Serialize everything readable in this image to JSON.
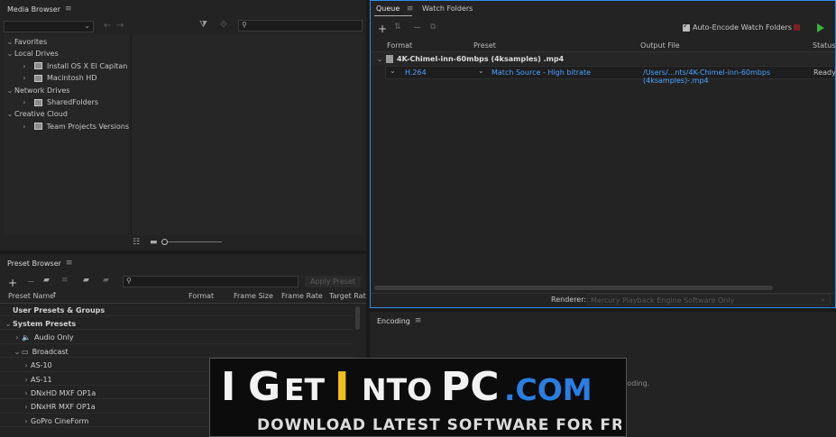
{
  "media_browser": {
    "title": "Media Browser",
    "tree": [
      {
        "label": "Favorites",
        "level": 0,
        "expanded": true,
        "icon": "none"
      },
      {
        "label": "Local Drives",
        "level": 0,
        "expanded": true,
        "icon": "none"
      },
      {
        "label": "Install OS X El Capitan",
        "level": 1,
        "expanded": false,
        "icon": "drive-icon"
      },
      {
        "label": "Macintosh HD",
        "level": 1,
        "expanded": false,
        "icon": "drive-icon"
      },
      {
        "label": "Network Drives",
        "level": 0,
        "expanded": true,
        "icon": "none"
      },
      {
        "label": "SharedFolders",
        "level": 1,
        "expanded": false,
        "icon": "drive-icon"
      },
      {
        "label": "Creative Cloud",
        "level": 0,
        "expanded": true,
        "icon": "none"
      },
      {
        "label": "Team Projects Versions",
        "level": 1,
        "expanded": false,
        "icon": "team-projects-icon"
      }
    ]
  },
  "preset_browser": {
    "title": "Preset Browser",
    "apply_preset": "Apply Preset",
    "columns": [
      "Preset Name",
      "Format",
      "Frame Size",
      "Frame Rate",
      "Target Rat"
    ],
    "rows": [
      {
        "label": "User Presets & Groups",
        "level": 0,
        "chev": "",
        "bold": true
      },
      {
        "label": "System Presets",
        "level": 0,
        "chev": "v",
        "bold": true
      },
      {
        "label": "Audio Only",
        "level": 1,
        "chev": ">",
        "icon": "speaker-icon"
      },
      {
        "label": "Broadcast",
        "level": 1,
        "chev": "v",
        "icon": "tv-icon"
      },
      {
        "label": "AS-10",
        "level": 2,
        "chev": ">"
      },
      {
        "label": "AS-11",
        "level": 2,
        "chev": ">"
      },
      {
        "label": "DNxHD MXF OP1a",
        "level": 2,
        "chev": ">"
      },
      {
        "label": "DNxHR MXF OP1a",
        "level": 2,
        "chev": ">"
      },
      {
        "label": "GoPro CineForm",
        "level": 2,
        "chev": ">"
      }
    ]
  },
  "queue": {
    "tab_queue": "Queue",
    "tab_watch": "Watch Folders",
    "auto_encode": "Auto-Encode Watch Folders",
    "columns": [
      "Format",
      "Preset",
      "Output File",
      "Status"
    ],
    "source_file": "4K-Chimel-inn-60mbps (4ksamples) .mp4",
    "item": {
      "format": "H.264",
      "preset": "Match Source - High bitrate",
      "output": "/Users/...nts/4K-Chimel-inn-60mbps (4ksamples)-.mp4",
      "status": "Ready"
    },
    "renderer_label": "Renderer:",
    "renderer_value": "Mercury Playback Engine Software Only"
  },
  "encoding": {
    "title": "Encoding",
    "status": "Not currently encoding."
  },
  "watermark": {
    "brand": "IGetIntoPC.com",
    "tagline": "Download Latest Software for Free"
  }
}
